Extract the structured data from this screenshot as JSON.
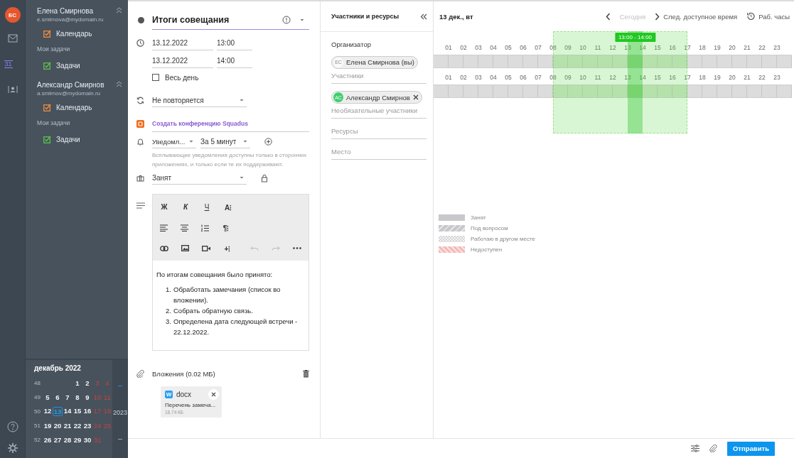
{
  "rail": {
    "avatar": "ЕС",
    "items": [
      {
        "kind": "mail",
        "selected": false
      },
      {
        "kind": "calendar",
        "label": "31",
        "selected": true
      },
      {
        "kind": "contacts",
        "selected": false
      }
    ]
  },
  "accounts": [
    {
      "name": "Елена Смирнова",
      "email": "e.smirnova@mydomain.ru",
      "expanded": true,
      "calendars": [
        {
          "label": "Календарь",
          "checked": true,
          "color": "#f08c3c"
        }
      ],
      "tasks_heading": "Мои задачи",
      "tasks": [
        {
          "label": "Задачи",
          "checked": true,
          "color": "#5cc24a"
        }
      ]
    },
    {
      "name": "Александр Смирнов",
      "email": "a.smirnov@mydomain.ru",
      "expanded": true,
      "calendars": [
        {
          "label": "Календарь",
          "checked": true,
          "color": "#f08c3c"
        }
      ],
      "tasks_heading": "Мои задачи",
      "tasks": [
        {
          "label": "Задачи",
          "checked": true,
          "color": "#5cc24a"
        }
      ]
    }
  ],
  "mini_calendar": {
    "title": "декабрь 2022",
    "year_label": "2023",
    "weeks": [
      {
        "number": "48",
        "days": [
          {
            "label": "1",
            "weekend": false,
            "selected": false
          },
          {
            "label": "2",
            "weekend": false,
            "selected": false
          },
          {
            "label": "3",
            "weekend": true,
            "selected": false
          },
          {
            "label": "4",
            "weekend": true,
            "selected": false
          }
        ]
      },
      {
        "number": "49",
        "days": [
          {
            "label": "5",
            "weekend": false,
            "selected": false
          },
          {
            "label": "6",
            "weekend": false,
            "selected": false
          },
          {
            "label": "7",
            "weekend": false,
            "selected": false
          },
          {
            "label": "8",
            "weekend": false,
            "selected": false
          },
          {
            "label": "9",
            "weekend": false,
            "selected": false
          },
          {
            "label": "10",
            "weekend": true,
            "selected": false
          },
          {
            "label": "11",
            "weekend": true,
            "selected": false
          }
        ]
      },
      {
        "number": "50",
        "days": [
          {
            "label": "12",
            "weekend": false,
            "selected": false
          },
          {
            "label": "13",
            "weekend": false,
            "selected": true
          },
          {
            "label": "14",
            "weekend": false,
            "selected": false
          },
          {
            "label": "15",
            "weekend": false,
            "selected": false
          },
          {
            "label": "16",
            "weekend": false,
            "selected": false
          },
          {
            "label": "17",
            "weekend": true,
            "selected": false
          },
          {
            "label": "18",
            "weekend": true,
            "selected": false
          }
        ]
      },
      {
        "number": "51",
        "days": [
          {
            "label": "19",
            "weekend": false,
            "selected": false
          },
          {
            "label": "20",
            "weekend": false,
            "selected": false
          },
          {
            "label": "21",
            "weekend": false,
            "selected": false
          },
          {
            "label": "22",
            "weekend": false,
            "selected": false
          },
          {
            "label": "23",
            "weekend": false,
            "selected": false
          },
          {
            "label": "24",
            "weekend": true,
            "selected": false
          },
          {
            "label": "25",
            "weekend": true,
            "selected": false
          }
        ]
      },
      {
        "number": "52",
        "days": [
          {
            "label": "26",
            "weekend": false,
            "selected": false
          },
          {
            "label": "27",
            "weekend": false,
            "selected": false
          },
          {
            "label": "28",
            "weekend": false,
            "selected": false
          },
          {
            "label": "29",
            "weekend": false,
            "selected": false
          },
          {
            "label": "30",
            "weekend": false,
            "selected": false
          },
          {
            "label": "31",
            "weekend": true,
            "selected": false
          }
        ]
      }
    ]
  },
  "event": {
    "title": "Итоги совещания",
    "start_date": "13.12.2022",
    "start_time": "13:00",
    "end_date": "13.12.2022",
    "end_time": "14:00",
    "all_day": {
      "label": "Весь день",
      "checked": false
    },
    "repeat": "Не повторяется",
    "conference_link": "Создать конференцию Squadus",
    "reminder_type": "Уведомл...",
    "reminder_time": "За 5 минут",
    "reminder_hint": "Всплывающие уведомления доступны только в сторонних приложениях, и только если те их поддерживают.",
    "status": "Занят",
    "toolbar": {
      "bold": "Ж",
      "italic": "К",
      "underline": "Ч",
      "font": "A⁝",
      "paragraph": "¶⁝",
      "insert": "+⁝",
      "undo_disabled": true,
      "redo_disabled": true
    },
    "body": {
      "intro": "По итогам совещания было принято:",
      "items": [
        {
          "number": "1.",
          "text": "Обработать замечания (список во вложении)."
        },
        {
          "number": "2.",
          "text": "Собрать обратную связь."
        },
        {
          "number": "3.",
          "text": "Определена дата следующей встречи - 22.12.2022."
        }
      ]
    },
    "attachments": {
      "title": "Вложения (0.02 МБ)",
      "files": [
        {
          "badge": "W",
          "type": "docx",
          "name": "Перечень замеча...",
          "size": "18.74 КБ"
        }
      ]
    }
  },
  "participants": {
    "title": "Участники и ресурсы",
    "organizer_label": "Организатор",
    "organizer": {
      "initials": "ЕС",
      "name": "Елена Смирнова (вы)"
    },
    "attendees_placeholder": "Участники",
    "attendees": [
      {
        "initials": "АС",
        "name": "Александр Смирнов"
      }
    ],
    "optional_placeholder": "Необязательные участники",
    "resources_placeholder": "Ресурсы",
    "place_placeholder": "Место"
  },
  "schedule": {
    "date": "13 дек., вт",
    "today": "Сегодня",
    "today_disabled": true,
    "next_free": "След. доступное время",
    "work_hours": "Раб. часы",
    "selection_label": "13:00 - 14:00",
    "slots": [
      {
        "working": false,
        "selected": false
      },
      {
        "working": false,
        "selected": false
      },
      {
        "working": false,
        "selected": false
      },
      {
        "working": false,
        "selected": false
      },
      {
        "working": false,
        "selected": false
      },
      {
        "working": false,
        "selected": false
      },
      {
        "working": false,
        "selected": false
      },
      {
        "working": false,
        "selected": false
      },
      {
        "working": true,
        "selected": false
      },
      {
        "working": true,
        "selected": false
      },
      {
        "working": true,
        "selected": false
      },
      {
        "working": true,
        "selected": false
      },
      {
        "working": true,
        "selected": false
      },
      {
        "working": true,
        "selected": true
      },
      {
        "working": true,
        "selected": false
      },
      {
        "working": true,
        "selected": false
      },
      {
        "working": true,
        "selected": false
      },
      {
        "working": false,
        "selected": false
      },
      {
        "working": false,
        "selected": false
      },
      {
        "working": false,
        "selected": false
      },
      {
        "working": false,
        "selected": false
      },
      {
        "working": false,
        "selected": false
      },
      {
        "working": false,
        "selected": false
      },
      {
        "working": false,
        "selected": false
      }
    ],
    "rows": [
      {
        "hours": [
          "01",
          "02",
          "03",
          "04",
          "05",
          "06",
          "07",
          "08",
          "09",
          "10",
          "11",
          "12",
          "13",
          "14",
          "15",
          "16",
          "17",
          "18",
          "19",
          "20",
          "21",
          "22",
          "23"
        ]
      },
      {
        "hours": [
          "01",
          "02",
          "03",
          "04",
          "05",
          "06",
          "07",
          "08",
          "09",
          "10",
          "11",
          "12",
          "13",
          "14",
          "15",
          "16",
          "17",
          "18",
          "19",
          "20",
          "21",
          "22",
          "23"
        ]
      }
    ],
    "legend": [
      {
        "kind": "busy",
        "label": "Занят"
      },
      {
        "kind": "tentative",
        "label": "Под вопросом"
      },
      {
        "kind": "elsewhere",
        "label": "Работаю в другом месте"
      },
      {
        "kind": "unavailable",
        "label": "Недоступен"
      }
    ]
  },
  "footer": {
    "send": "Отправить"
  }
}
